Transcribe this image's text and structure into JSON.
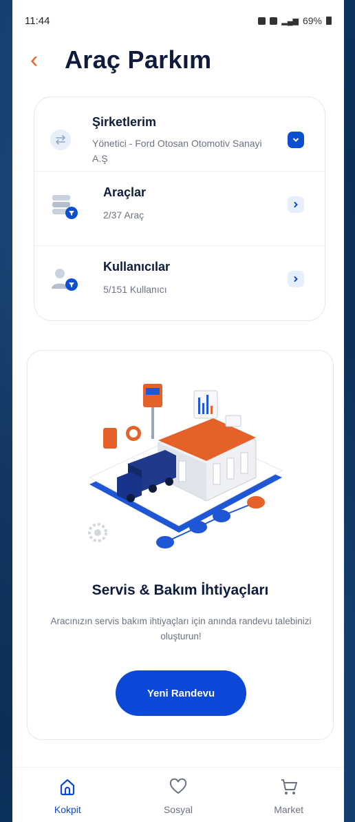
{
  "status": {
    "time": "11:44",
    "battery": "69%"
  },
  "header": {
    "title": "Araç Parkım"
  },
  "fleet_card": {
    "companies": {
      "title": "Şirketlerim",
      "subtitle": "Yönetici - Ford Otosan Otomotiv Sanayi A.Ş"
    },
    "vehicles": {
      "title": "Araçlar",
      "subtitle": "2/37 Araç"
    },
    "users": {
      "title": "Kullanıcılar",
      "subtitle": "5/151 Kullanıcı"
    }
  },
  "promo": {
    "title": "Servis & Bakım İhtiyaçları",
    "description": "Aracınızın servis bakım ihtiyaçları için anında randevu talebinizi oluşturun!",
    "button": "Yeni Randevu"
  },
  "tabbar": [
    {
      "label": "Kokpit",
      "icon": "home-icon",
      "active": true
    },
    {
      "label": "Sosyal",
      "icon": "heart-icon",
      "active": false
    },
    {
      "label": "Market",
      "icon": "cart-icon",
      "active": false
    }
  ],
  "colors": {
    "accent": "#0b48d8",
    "back": "#e4622a",
    "title": "#0e1b3d",
    "background": "#0b2d52"
  }
}
